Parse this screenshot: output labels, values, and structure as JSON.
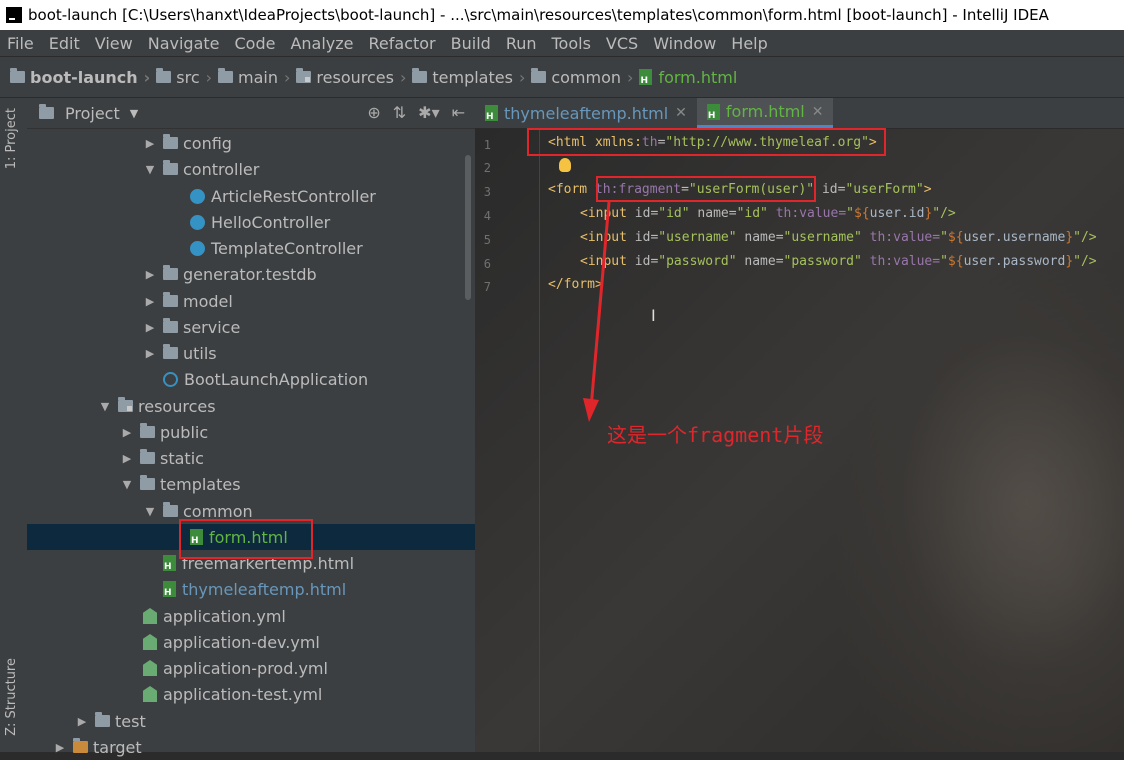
{
  "window": {
    "title": "boot-launch [C:\\Users\\hanxt\\IdeaProjects\\boot-launch] - ...\\src\\main\\resources\\templates\\common\\form.html [boot-launch] - IntelliJ IDEA"
  },
  "menu": [
    "File",
    "Edit",
    "View",
    "Navigate",
    "Code",
    "Analyze",
    "Refactor",
    "Build",
    "Run",
    "Tools",
    "VCS",
    "Window",
    "Help"
  ],
  "breadcrumb": [
    "boot-launch",
    "src",
    "main",
    "resources",
    "templates",
    "common",
    "form.html"
  ],
  "side_tabs": {
    "project": "1: Project",
    "structure": "Z: Structure"
  },
  "project_panel": {
    "title": "Project",
    "tree": [
      {
        "label": "config",
        "icon": "folder-icon",
        "expanded": false
      },
      {
        "label": "controller",
        "icon": "folder-icon",
        "expanded": true
      },
      {
        "label": "ArticleRestController",
        "icon": "class-icon"
      },
      {
        "label": "HelloController",
        "icon": "class-icon"
      },
      {
        "label": "TemplateController",
        "icon": "class-icon"
      },
      {
        "label": "generator.testdb",
        "icon": "folder-icon",
        "expanded": false
      },
      {
        "label": "model",
        "icon": "folder-icon",
        "expanded": false
      },
      {
        "label": "service",
        "icon": "folder-icon",
        "expanded": false
      },
      {
        "label": "utils",
        "icon": "folder-icon",
        "expanded": false
      },
      {
        "label": "BootLaunchApplication",
        "icon": "spring-boot-icon"
      },
      {
        "label": "resources",
        "icon": "resources-folder-icon",
        "expanded": true
      },
      {
        "label": "public",
        "icon": "folder-icon",
        "expanded": false
      },
      {
        "label": "static",
        "icon": "folder-icon",
        "expanded": false
      },
      {
        "label": "templates",
        "icon": "folder-icon",
        "expanded": true
      },
      {
        "label": "common",
        "icon": "folder-icon",
        "expanded": true
      },
      {
        "label": "form.html",
        "icon": "html-file-icon",
        "selected": true
      },
      {
        "label": "freemarkertemp.html",
        "icon": "html-file-icon"
      },
      {
        "label": "thymeleaftemp.html",
        "icon": "html-file-icon"
      },
      {
        "label": "application.yml",
        "icon": "yml-icon"
      },
      {
        "label": "application-dev.yml",
        "icon": "yml-icon"
      },
      {
        "label": "application-prod.yml",
        "icon": "yml-icon"
      },
      {
        "label": "application-test.yml",
        "icon": "yml-icon"
      },
      {
        "label": "test",
        "icon": "folder-icon",
        "expanded": false
      },
      {
        "label": "target",
        "icon": "folder-icon",
        "expanded": false
      }
    ]
  },
  "editor": {
    "tabs": [
      {
        "label": "thymeleaftemp.html",
        "active": false
      },
      {
        "label": "form.html",
        "active": true
      }
    ],
    "line_numbers": [
      "1",
      "2",
      "3",
      "4",
      "5",
      "6",
      "7"
    ],
    "code": {
      "l1_open": "<html xmlns:",
      "l1_ns": "th",
      "l1_eq": "=",
      "l1_val": "\"http://www.thymeleaf.org\"",
      "l1_close": ">",
      "l3_open": "<form ",
      "l3_attr": "th:fragment",
      "l3_eq": "=",
      "l3_val": "\"userForm(user)\"",
      "l3_id": " id=",
      "l3_idval": "\"userForm\"",
      "l3_close": ">",
      "l4_tag": "<input",
      "l4_attrs": " id=",
      "l4_v1": "\"id\"",
      "l4_n": " name=",
      "l4_v2": "\"id\"",
      "l4_th": " th:value=",
      "l4_v3a": "\"",
      "l4_d": "${",
      "l4_e": "user.id",
      "l4_d2": "}",
      "l4_end": "\"/>",
      "l5_tag": "<input",
      "l5_a1": " id=",
      "l5_v1": "\"username\"",
      "l5_a2": " name=",
      "l5_v2": "\"username\"",
      "l5_a3": " th:value=",
      "l5_q": "\"",
      "l5_d": "${",
      "l5_e": "user.username",
      "l5_d2": "}",
      "l5_end": "\"/>",
      "l6_tag": "<input",
      "l6_a1": " id=",
      "l6_v1": "\"password\"",
      "l6_a2": " name=",
      "l6_v2": "\"password\"",
      "l6_a3": " th:value=",
      "l6_q": "\"",
      "l6_d": "${",
      "l6_e": "user.password",
      "l6_d2": "}",
      "l6_end": "\"/>",
      "l7": "</form>"
    },
    "annotation": "这是一个fragment片段"
  },
  "colors": {
    "highlight_box": "#e0262b",
    "accent_green": "#62b543",
    "selection": "#0d293e"
  }
}
